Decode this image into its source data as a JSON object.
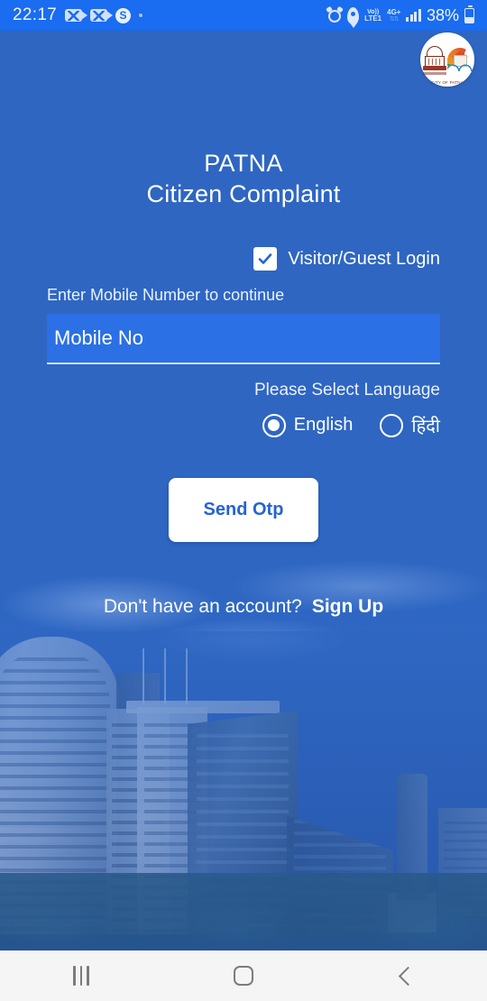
{
  "status_bar": {
    "time": "22:17",
    "battery_percent": "38%",
    "network_volte_top": "Vo))",
    "network_volte_bottom": "LTE1",
    "network_gen": "4G+",
    "icons": [
      "video-call-muted-icon",
      "video-call-muted-icon",
      "skype-icon",
      "dot-indicator-icon",
      "alarm-icon",
      "location-pin-icon",
      "signal-bars-icon",
      "battery-icon"
    ],
    "skype_letter": "S"
  },
  "logo": {
    "name": "patna-municipal-corporation-logo",
    "caption": "CITY OF PATNA"
  },
  "header": {
    "line1": "PATNA",
    "line2": "Citizen Complaint"
  },
  "guest_login": {
    "label": "Visitor/Guest Login",
    "checked": true
  },
  "mobile_field": {
    "label": "Enter Mobile Number to continue",
    "placeholder": "Mobile No",
    "value": ""
  },
  "language": {
    "label": "Please Select Language",
    "options": [
      {
        "label": "English",
        "selected": true
      },
      {
        "label": "हिंदी",
        "selected": false
      }
    ]
  },
  "primary_action": {
    "label": "Send Otp"
  },
  "signup": {
    "question": "Don't have an account?",
    "link": "Sign Up"
  },
  "nav_bar": {
    "recents": "recents-icon",
    "home": "home-icon",
    "back": "back-icon"
  },
  "colors": {
    "background_blue": "#2e66c2",
    "status_bar_blue": "#1a6cf0",
    "input_fill_blue": "#2b70e4",
    "button_text_blue": "#2563d6",
    "white": "#ffffff",
    "nav_bar_grey": "#f5f5f5"
  }
}
